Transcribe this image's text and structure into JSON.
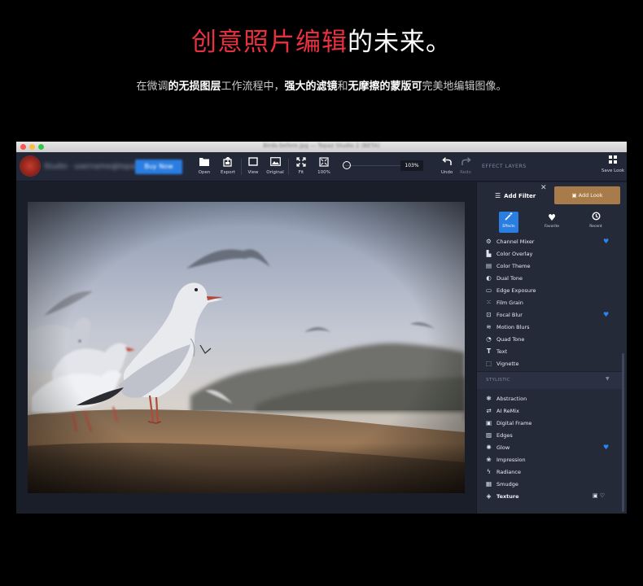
{
  "hero": {
    "title_red": "创意照片编辑",
    "title_white": "的未来。",
    "subtitle": {
      "p1": "在微调",
      "b1": "的无损图层",
      "p2": "工作流程中，",
      "b2": "强大的滤镜",
      "p3": "和",
      "b3": "无摩擦的蒙版可",
      "p4": "完美地编辑图像。"
    }
  },
  "window": {
    "title": "Birds-before.jpg — Topaz Studio 2 (BETA)"
  },
  "toolbar": {
    "account_text": "Studio · username@topazlabs.com",
    "buy_label": "Buy Now",
    "buttons": [
      {
        "label": "Open",
        "icon": "folder-icon"
      },
      {
        "label": "Export",
        "icon": "export-icon"
      },
      {
        "label": "View",
        "icon": "view-icon"
      },
      {
        "label": "Original",
        "icon": "image-icon"
      },
      {
        "label": "Fit",
        "icon": "fit-icon"
      },
      {
        "label": "100%",
        "icon": "fullsize-icon"
      }
    ],
    "zoom_value": "103%",
    "undo_label": "Undo",
    "redo_label": "Redo",
    "effect_layers_label": "EFFECT LAYERS",
    "save_look_label": "Save Look"
  },
  "panel": {
    "add_filter_label": "Add Filter",
    "add_look_label": "Add Look",
    "tabs": [
      {
        "label": "Effects",
        "icon": "wand-icon",
        "active": true
      },
      {
        "label": "Favorite",
        "icon": "heart-icon",
        "active": false
      },
      {
        "label": "Recent",
        "icon": "clock-icon",
        "active": false
      }
    ],
    "effects": [
      {
        "name": "Channel Mixer",
        "icon": "mixer-icon",
        "fav": true
      },
      {
        "name": "Color Overlay",
        "icon": "overlay-icon",
        "fav": false
      },
      {
        "name": "Color Theme",
        "icon": "theme-icon",
        "fav": false
      },
      {
        "name": "Dual Tone",
        "icon": "dualtone-icon",
        "fav": false
      },
      {
        "name": "Edge Exposure",
        "icon": "exposure-icon",
        "fav": false
      },
      {
        "name": "Film Grain",
        "icon": "grain-icon",
        "fav": false
      },
      {
        "name": "Focal Blur",
        "icon": "focal-icon",
        "fav": true
      },
      {
        "name": "Motion Blurs",
        "icon": "motion-icon",
        "fav": false
      },
      {
        "name": "Quad Tone",
        "icon": "quadtone-icon",
        "fav": false
      },
      {
        "name": "Text",
        "icon": "text-icon",
        "fav": false
      },
      {
        "name": "Vignette",
        "icon": "vignette-icon",
        "fav": false
      }
    ],
    "stylistic_label": "STYLISTIC",
    "stylistic": [
      {
        "name": "Abstraction",
        "icon": "abstraction-icon",
        "fav": false
      },
      {
        "name": "AI ReMix",
        "icon": "remix-icon",
        "fav": false
      },
      {
        "name": "Digital Frame",
        "icon": "frame-icon",
        "fav": false
      },
      {
        "name": "Edges",
        "icon": "edges-icon",
        "fav": false
      },
      {
        "name": "Glow",
        "icon": "glow-icon",
        "fav": true
      },
      {
        "name": "Impression",
        "icon": "impression-icon",
        "fav": false
      },
      {
        "name": "Radiance",
        "icon": "radiance-icon",
        "fav": false
      },
      {
        "name": "Smudge",
        "icon": "smudge-icon",
        "fav": false
      },
      {
        "name": "Texture",
        "icon": "texture-icon",
        "fav": false,
        "hover": true
      }
    ]
  },
  "colors": {
    "accent_blue": "#2a7de1",
    "title_red": "#e8303f",
    "add_look_gold": "#a77c4a",
    "panel_bg": "#252a39"
  }
}
